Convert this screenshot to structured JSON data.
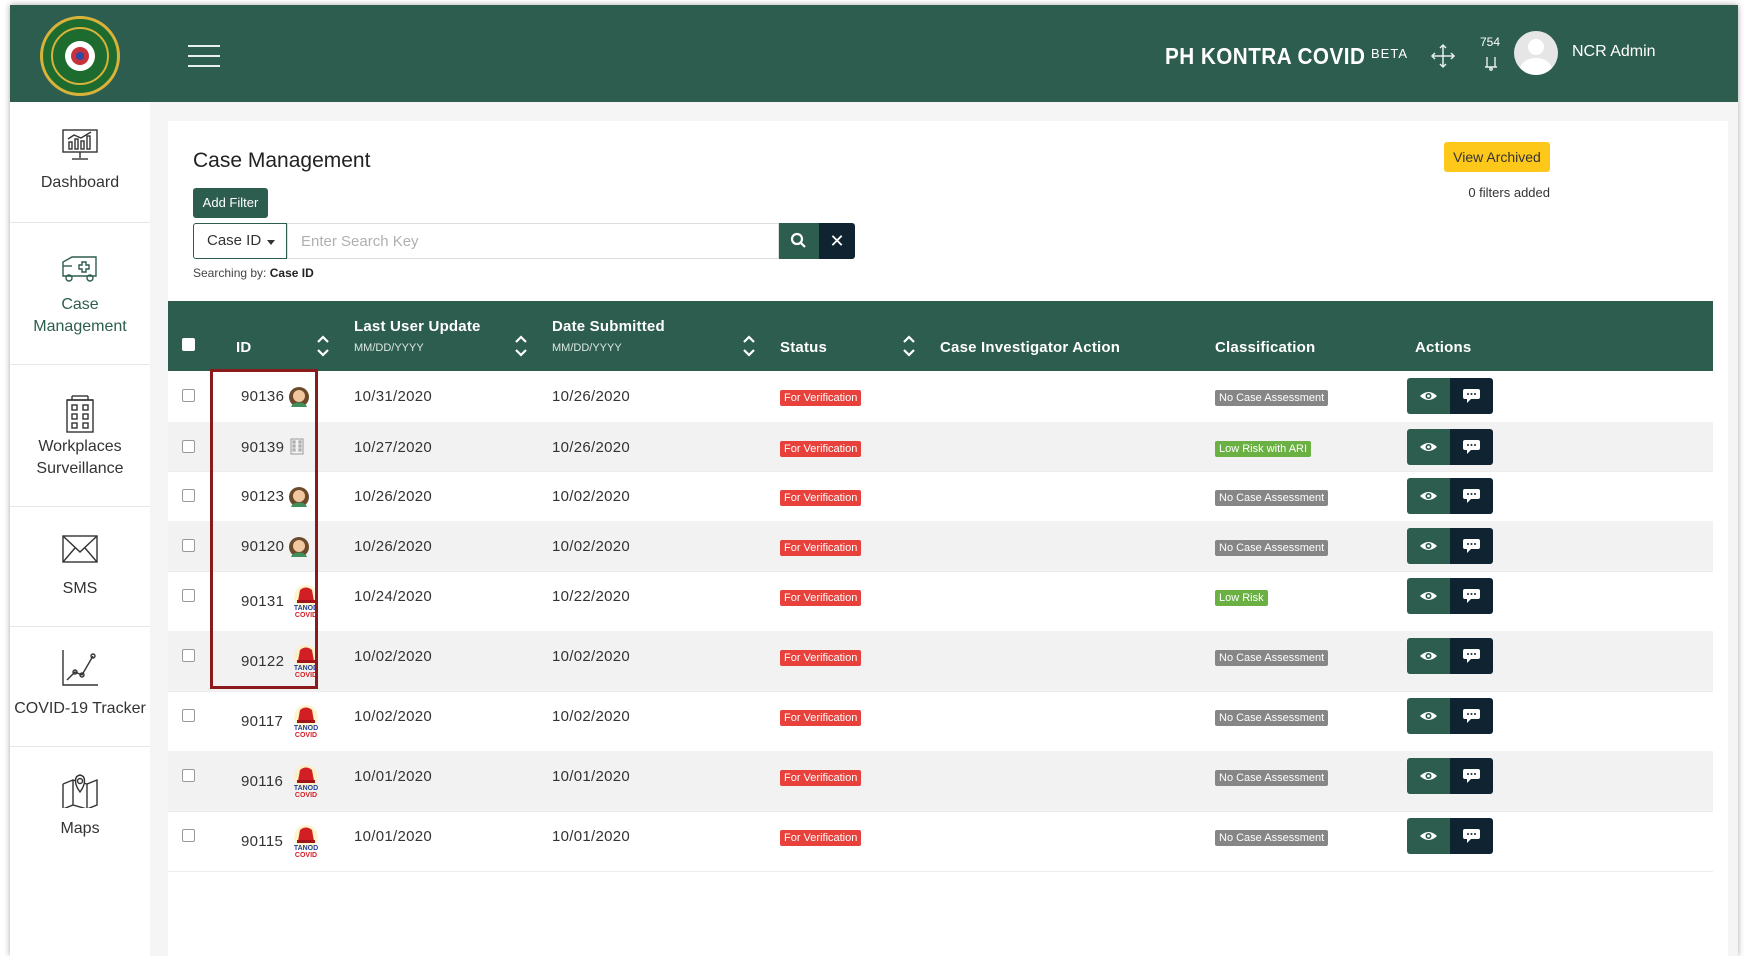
{
  "app": {
    "brand": "PH KONTRA COVID",
    "beta": "BETA",
    "notifications_count": "754",
    "user_name": "NCR Admin"
  },
  "sidebar": {
    "items": [
      {
        "label_lines": [
          "Dashboard"
        ],
        "icon": "dashboard-icon"
      },
      {
        "label_lines": [
          "Case",
          "Management"
        ],
        "icon": "ambulance-icon",
        "active": true
      },
      {
        "label_lines": [
          "Workplaces",
          "Surveillance"
        ],
        "icon": "building-icon"
      },
      {
        "label_lines": [
          "SMS"
        ],
        "icon": "envelope-icon"
      },
      {
        "label_lines": [
          "COVID-19 Tracker"
        ],
        "icon": "line-chart-icon"
      },
      {
        "label_lines": [
          "Maps"
        ],
        "icon": "map-pin-icon"
      }
    ]
  },
  "main": {
    "title": "Case Management",
    "add_filter_label": "Add Filter",
    "view_archived_label": "View Archived",
    "filters_added": "0 filters added",
    "search": {
      "field": "Case ID",
      "placeholder": "Enter Search Key",
      "searching_by_prefix": "Searching by:",
      "searching_by_value": "Case ID"
    }
  },
  "table": {
    "headers": {
      "id": "ID",
      "last_update": "Last User Update",
      "last_update_fmt": "MM/DD/YYYY",
      "date_submitted": "Date Submitted",
      "date_submitted_fmt": "MM/DD/YYYY",
      "status": "Status",
      "investigator_action": "Case Investigator Action",
      "classification": "Classification",
      "actions": "Actions"
    },
    "rows": [
      {
        "id": "90136",
        "source": "avatar",
        "last_update": "10/31/2020",
        "date_submitted": "10/26/2020",
        "status": "For Verification",
        "classification": "No Case Assessment",
        "class_color": "gray"
      },
      {
        "id": "90139",
        "source": "building",
        "last_update": "10/27/2020",
        "date_submitted": "10/26/2020",
        "status": "For Verification",
        "classification": "Low Risk with ARI",
        "class_color": "green"
      },
      {
        "id": "90123",
        "source": "avatar",
        "last_update": "10/26/2020",
        "date_submitted": "10/02/2020",
        "status": "For Verification",
        "classification": "No Case Assessment",
        "class_color": "gray"
      },
      {
        "id": "90120",
        "source": "avatar",
        "last_update": "10/26/2020",
        "date_submitted": "10/02/2020",
        "status": "For Verification",
        "classification": "No Case Assessment",
        "class_color": "gray"
      },
      {
        "id": "90131",
        "source": "tanod",
        "last_update": "10/24/2020",
        "date_submitted": "10/22/2020",
        "status": "For Verification",
        "classification": "Low Risk",
        "class_color": "green"
      },
      {
        "id": "90122",
        "source": "tanod",
        "last_update": "10/02/2020",
        "date_submitted": "10/02/2020",
        "status": "For Verification",
        "classification": "No Case Assessment",
        "class_color": "gray"
      },
      {
        "id": "90117",
        "source": "tanod",
        "last_update": "10/02/2020",
        "date_submitted": "10/02/2020",
        "status": "For Verification",
        "classification": "No Case Assessment",
        "class_color": "gray"
      },
      {
        "id": "90116",
        "source": "tanod",
        "last_update": "10/01/2020",
        "date_submitted": "10/01/2020",
        "status": "For Verification",
        "classification": "No Case Assessment",
        "class_color": "gray"
      },
      {
        "id": "90115",
        "source": "tanod",
        "last_update": "10/01/2020",
        "date_submitted": "10/01/2020",
        "status": "For Verification",
        "classification": "No Case Assessment",
        "class_color": "gray"
      }
    ],
    "tanod_label": [
      "TANOD",
      "COVID"
    ]
  },
  "colors": {
    "primary": "#2d5d4e",
    "dark": "#0f2331",
    "accent_yellow": "#fec81a",
    "status_red": "#e8413c",
    "class_gray": "#868686",
    "class_green": "#6ab043",
    "highlight": "#8b1a1a"
  }
}
